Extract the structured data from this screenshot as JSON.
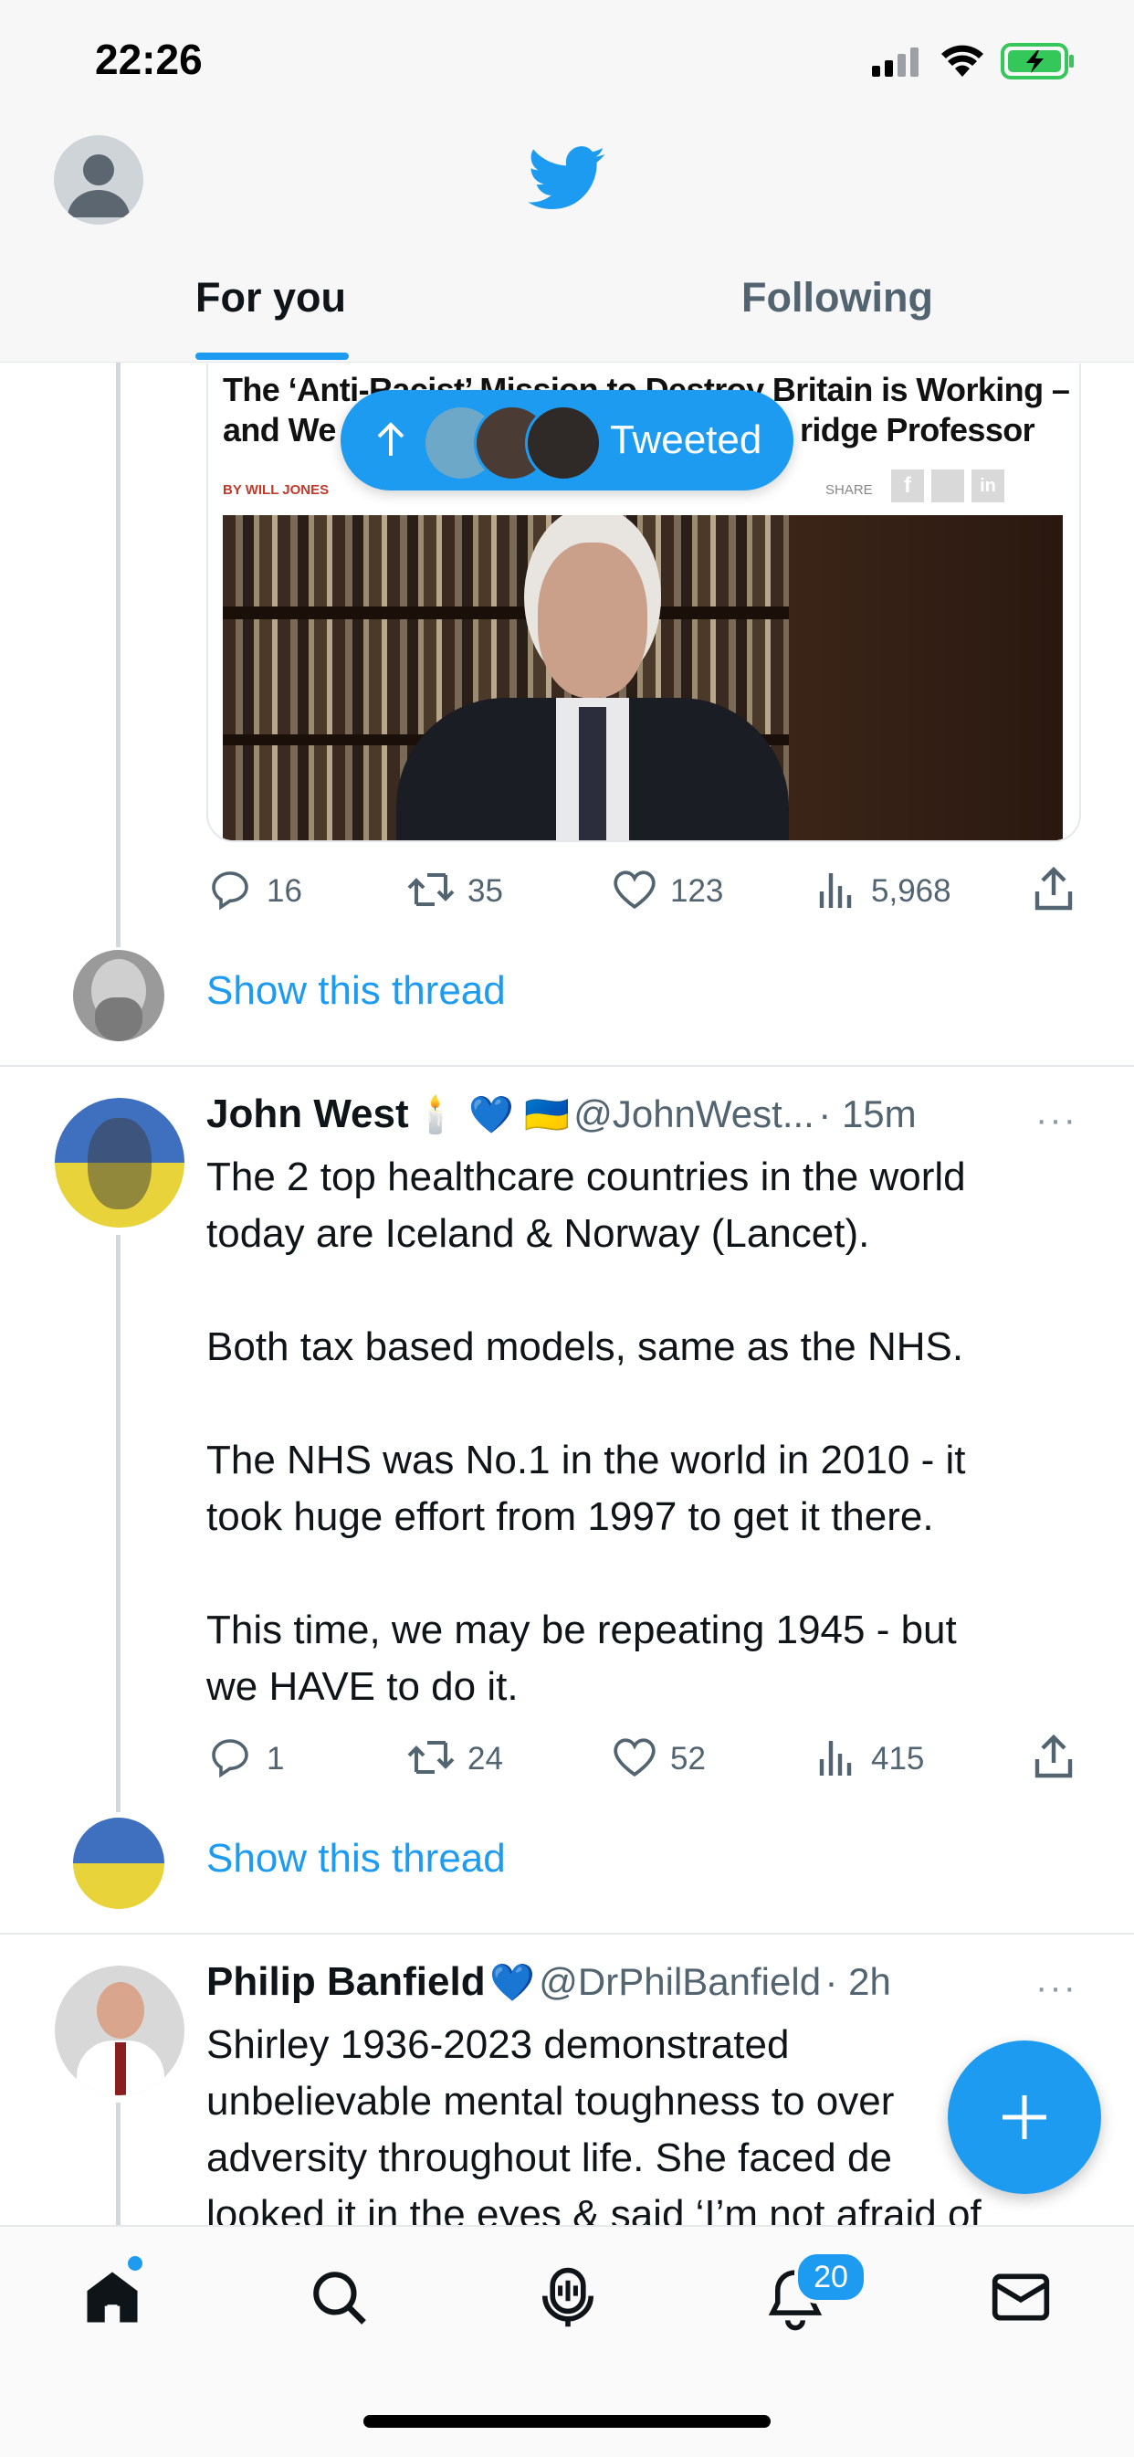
{
  "status_bar": {
    "time": "22:26"
  },
  "header": {
    "tabs": [
      {
        "label": "For you",
        "active": true
      },
      {
        "label": "Following",
        "active": false
      }
    ]
  },
  "pill": {
    "label": "Tweeted"
  },
  "embed": {
    "headline_line1": "The ‘Anti-Racist’ Mission to Destroy Britain is Working –",
    "headline_line2_left": "and We",
    "headline_line2_right": "ridge Professor",
    "byline_author": "BY WILL JONES",
    "share_label": "SHARE"
  },
  "tweets": [
    {
      "actions": {
        "replies": "16",
        "retweets": "35",
        "likes": "123",
        "views": "5,968"
      },
      "show_thread": "Show this thread"
    },
    {
      "name": "John West",
      "emojis": "🕯️ 💙 🇺🇦",
      "handle": "@JohnWest...",
      "time": "· 15m",
      "paragraphs": [
        "The 2 top healthcare countries in the world",
        "today are Iceland & Norway (Lancet).",
        "Both tax based models, same as the NHS.",
        "The NHS was No.1 in the world in 2010 - it",
        "took huge effort from 1997 to get it there.",
        "This time, we may be repeating 1945 - but",
        "we HAVE to do it."
      ],
      "actions": {
        "replies": "1",
        "retweets": "24",
        "likes": "52",
        "views": "415"
      },
      "show_thread": "Show this thread"
    },
    {
      "name": "Philip Banfield",
      "emojis": "💙",
      "handle": "@DrPhilBanfield",
      "time": "· 2h",
      "lines": [
        "Shirley 1936-2023 demonstrated",
        "unbelievable mental toughness to over",
        "adversity throughout life. She faced de",
        "looked it in the eyes & said ‘I’m not afraid of"
      ]
    }
  ],
  "bottom_nav": {
    "notification_count": "20"
  },
  "colors": {
    "accent": "#1d9bf0",
    "text": "#0f1419",
    "muted": "#536471"
  }
}
